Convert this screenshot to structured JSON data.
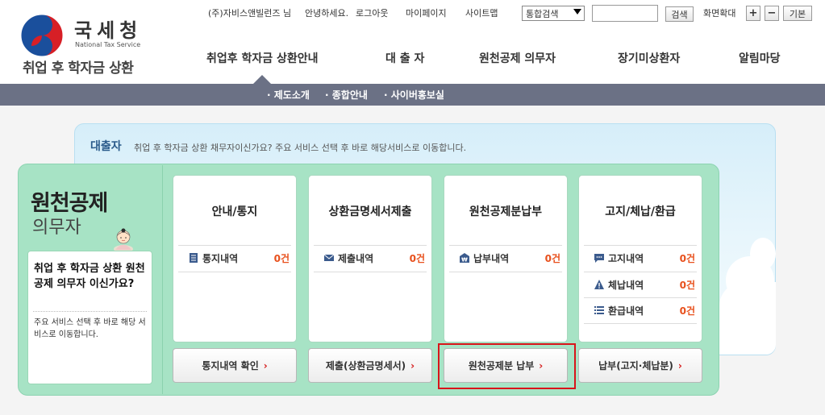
{
  "logo": {
    "title": "국세청",
    "english": "National Tax Service",
    "subtitle": "취업 후 학자금 상환"
  },
  "util_bar": {
    "user": "(주)자비스앤빌런즈 님",
    "greeting": "안녕하세요.",
    "logout": "로그아웃",
    "mypage": "마이페이지",
    "sitemap": "사이트맵",
    "search_select": "통합검색",
    "search_button": "검색",
    "zoom_label": "화면확대",
    "zoom_in": "+",
    "zoom_out": "−",
    "zoom_reset": "기본"
  },
  "gnb": [
    "취업후 학자금 상환안내",
    "대 출 자",
    "원천공제 의무자",
    "장기미상환자",
    "알림마당"
  ],
  "subnav": [
    "· 제도소개",
    "· 종합안내",
    "· 사이버홍보실"
  ],
  "borrower_panel": {
    "title": "대출자",
    "description": "취업 후 학자금 상환 채무자이신가요? 주요 서비스 선택 후 바로 해당서비스로 이동합니다."
  },
  "employer_panel": {
    "title": "원천공제",
    "subtitle": "의무자",
    "question": "취업 후 학자금 상환 원천공제 의무자 이신가요?",
    "description": "주요 서비스 선택 후 바로 해당 서비스로 이동합니다."
  },
  "cards": [
    {
      "title": "안내/통지",
      "rows": [
        {
          "icon": "document-icon",
          "label": "통지내역",
          "count": "0건"
        }
      ],
      "button": "통지내역 확인"
    },
    {
      "title": "상환금명세서제출",
      "rows": [
        {
          "icon": "envelope-icon",
          "label": "제출내역",
          "count": "0건"
        }
      ],
      "button": "제출(상환금명세서)"
    },
    {
      "title": "원천공제분납부",
      "rows": [
        {
          "icon": "won-envelope-icon",
          "label": "납부내역",
          "count": "0건"
        }
      ],
      "button": "원천공제분 납부"
    },
    {
      "title": "고지/체납/환급",
      "rows": [
        {
          "icon": "speech-bubble-icon",
          "label": "고지내역",
          "count": "0건"
        },
        {
          "icon": "warning-icon",
          "label": "체납내역",
          "count": "0건"
        },
        {
          "icon": "list-icon",
          "label": "환급내역",
          "count": "0건"
        }
      ],
      "button": "납부(고지·체납분)"
    }
  ],
  "colors": {
    "green_panel": "#a7e3c5",
    "subnav": "#6b7185",
    "count": "#e8501c",
    "highlight": "#d9141a"
  }
}
